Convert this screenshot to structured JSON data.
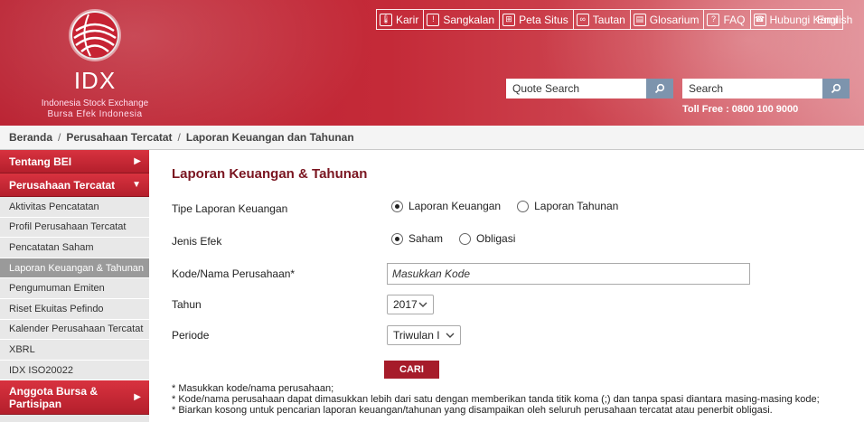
{
  "logo": {
    "name": "IDX",
    "sub1": "Indonesia Stock Exchange",
    "sub2": "Bursa Efek Indonesia"
  },
  "topnav": [
    {
      "label": "Karir",
      "icon": "thermometer-icon"
    },
    {
      "label": "Sangkalan",
      "icon": "exclamation-icon"
    },
    {
      "label": "Peta Situs",
      "icon": "sitemap-icon"
    },
    {
      "label": "Tautan",
      "icon": "link-icon"
    },
    {
      "label": "Glosarium",
      "icon": "book-icon"
    },
    {
      "label": "FAQ",
      "icon": "question-icon"
    },
    {
      "label": "Hubungi Kami",
      "icon": "phone-icon"
    }
  ],
  "language": "English",
  "quote_search": {
    "placeholder": "Quote Search"
  },
  "site_search": {
    "placeholder": "Search"
  },
  "tollfree": "Toll Free : 0800 100 9000",
  "breadcrumb": [
    "Beranda",
    "Perusahaan Tercatat",
    "Laporan Keuangan dan Tahunan"
  ],
  "sidebar": {
    "section1": "Tentang BEI",
    "section2": "Perusahaan Tercatat",
    "items": [
      "Aktivitas Pencatatan",
      "Profil Perusahaan Tercatat",
      "Pencatatan Saham",
      "Laporan Keuangan & Tahunan",
      "Pengumuman Emiten",
      "Riset Ekuitas Pefindo",
      "Kalender Perusahaan Tercatat",
      "XBRL",
      "IDX ISO20022"
    ],
    "active_index": 3,
    "section3_line1": "Anggota Bursa &",
    "section3_line2": "Partisipan"
  },
  "form": {
    "title": "Laporan Keuangan & Tahunan",
    "tipe_label": "Tipe Laporan Keuangan",
    "tipe_options": [
      "Laporan Keuangan",
      "Laporan Tahunan"
    ],
    "tipe_selected": "Laporan Keuangan",
    "jenis_label": "Jenis Efek",
    "jenis_options": [
      "Saham",
      "Obligasi"
    ],
    "jenis_selected": "Saham",
    "kode_label": "Kode/Nama Perusahaan*",
    "kode_placeholder": "Masukkan Kode",
    "tahun_label": "Tahun",
    "tahun_value": "2017",
    "periode_label": "Periode",
    "periode_value": "Triwulan I",
    "submit_label": "CARI",
    "notes": [
      "* Masukkan kode/nama perusahaan;",
      "* Kode/nama perusahaan dapat dimasukkan lebih dari satu dengan memberikan tanda titik koma (;) dan tanpa spasi diantara masing-masing kode;",
      "* Biarkan kosong untuk pencarian laporan keuangan/tahunan yang disampaikan oleh seluruh perusahaan tercatat atau penerbit obligasi."
    ]
  }
}
